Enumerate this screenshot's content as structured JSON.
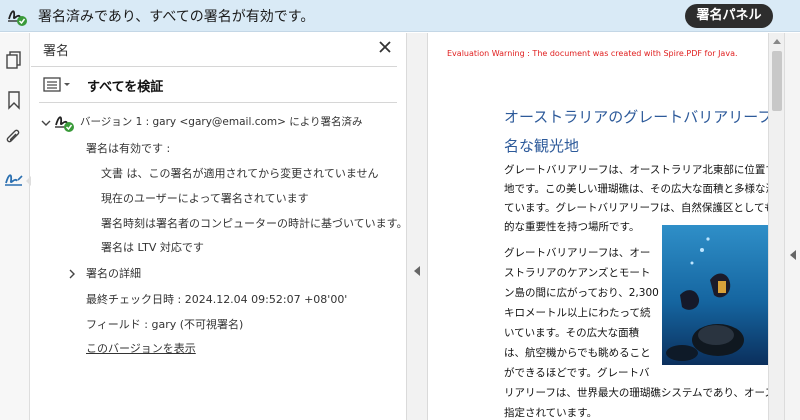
{
  "banner": {
    "message": "署名済みであり、すべての署名が有効です。",
    "panel_button": "署名パネル",
    "accent_color": "#d9eaf6"
  },
  "rail": {
    "icons": [
      "pages-icon",
      "bookmark-icon",
      "attachment-icon",
      "signature-icon"
    ]
  },
  "panel": {
    "title": "署名",
    "verify_all": "すべてを検証",
    "version_line": "バージョン 1 : gary <gary@email.com> により署名済み",
    "valid_heading": "署名は有効です :",
    "details": [
      "文書 は、この署名が適用されてから変更されていません",
      "現在のユーザーによって署名されています",
      "署名時刻は署名者のコンピューターの時計に基づいています。",
      "署名は LTV 対応です"
    ],
    "sig_details": "署名の詳細",
    "last_check": "最終チェック日時 : 2024.12.04 09:52:07 +08'00'",
    "field": "フィールド : gary (不可視署名)",
    "show_version": "このバージョンを表示"
  },
  "document": {
    "warning": "Evaluation Warning : The document was created with Spire.PDF for Java.",
    "heading_lines": [
      "オーストラリアのグレートバリアリーフ",
      "名な観光地"
    ],
    "para1": [
      "グレートバリアリーフは、オーストラリア北東部に位置す",
      "地です。この美しい珊瑚礁は、その広大な面積と多様な海",
      "ています。グレートバリアリーフは、自然保護区としても",
      "的な重要性を持つ場所です。"
    ],
    "para2": [
      "グレートバリアリーフは、オー",
      "ストラリアのケアンズとモート",
      "ン島の間に広がっており、2,300",
      "キロメートル以上にわたって続",
      "いています。その広大な面積",
      "は、航空機からでも眺めること",
      "ができるほどです。グレートバ",
      "リアリーフは、世界最大の珊瑚礁システムであり、オース",
      "指定されています。"
    ]
  }
}
